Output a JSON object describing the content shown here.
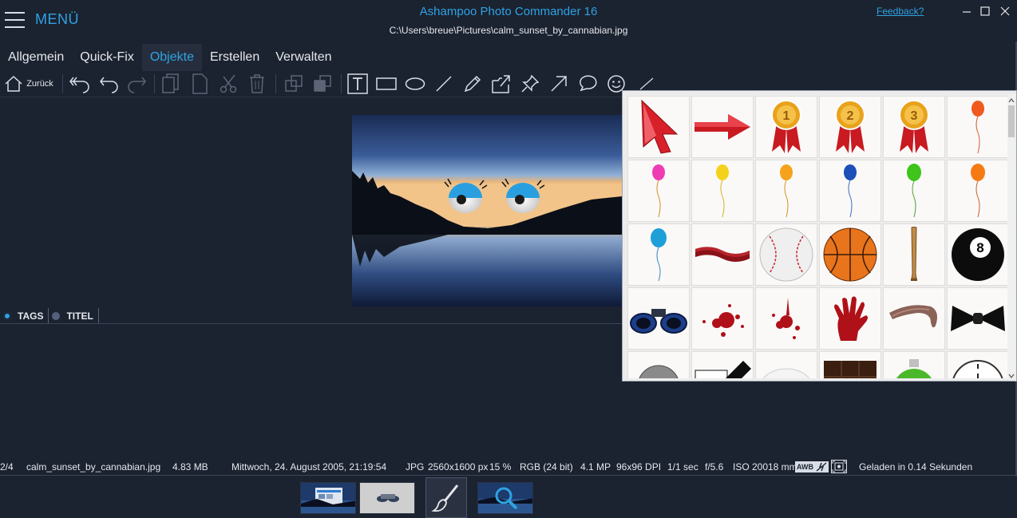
{
  "app": {
    "menu_label": "MENÜ",
    "title": "Ashampoo Photo Commander 16",
    "file_path": "C:\\Users\\breue\\Pictures\\calm_sunset_by_cannabian.jpg",
    "feedback": "Feedback?"
  },
  "tabs": [
    {
      "label": "Allgemein",
      "active": false
    },
    {
      "label": "Quick-Fix",
      "active": false
    },
    {
      "label": "Objekte",
      "active": true
    },
    {
      "label": "Erstellen",
      "active": false
    },
    {
      "label": "Verwalten",
      "active": false
    }
  ],
  "toolbar": {
    "back_label": "Zurück",
    "tools": [
      "undo-all-icon",
      "undo-icon",
      "redo-icon",
      "copy-icon",
      "paste-icon",
      "cut-icon",
      "delete-icon",
      "bring-forward-icon",
      "send-backward-icon",
      "text-tool-icon",
      "rectangle-tool-icon",
      "ellipse-tool-icon",
      "line-tool-icon",
      "pencil-tool-icon",
      "export-icon",
      "pin-icon",
      "arrow-tool-icon",
      "speech-bubble-icon",
      "smiley-icon",
      "small-line-icon"
    ]
  },
  "tag_tabs": [
    {
      "label": "TAGS",
      "selected": true
    },
    {
      "label": "TITEL",
      "selected": false
    }
  ],
  "status": {
    "position": "2/4",
    "filename": "calm_sunset_by_cannabian.jpg",
    "filesize": "4.83 MB",
    "date": "Mittwoch, 24. August 2005, 21:19:54",
    "format": "JPG",
    "dimensions": "2560x1600 px",
    "zoom": "15 %",
    "color": "RGB (24 bit)",
    "megapixels": "4.1 MP",
    "dpi": "96x96 DPI",
    "exposure": "1/1 sec",
    "aperture": "f/5.6",
    "iso": "ISO 200",
    "focal": "18 mm",
    "awb": "AWB",
    "loaded": "Geladen in 0.14 Sekunden"
  },
  "objects": [
    "red-cursor-arrow",
    "red-arrow",
    "medal-1",
    "medal-2",
    "medal-3",
    "balloon-red",
    "balloon-pink",
    "balloon-yellow",
    "balloon-orange",
    "balloon-blue",
    "balloon-green",
    "balloon-orange-2",
    "balloon-cyan",
    "red-ribbon",
    "baseball",
    "basketball",
    "baseball-bat",
    "eight-ball",
    "binoculars",
    "blood-splatter",
    "blood-splatter-2",
    "bloody-handprint",
    "feather-boa",
    "bow-tie",
    "saw-blade",
    "black-bar",
    "white-cloth",
    "chocolate-bar",
    "christmas-ornament",
    "clock"
  ],
  "medal_numbers": [
    "1",
    "2",
    "3"
  ],
  "eight_ball_label": "8",
  "colors": {
    "background": "#1b2230",
    "accent": "#2ea3e3"
  }
}
